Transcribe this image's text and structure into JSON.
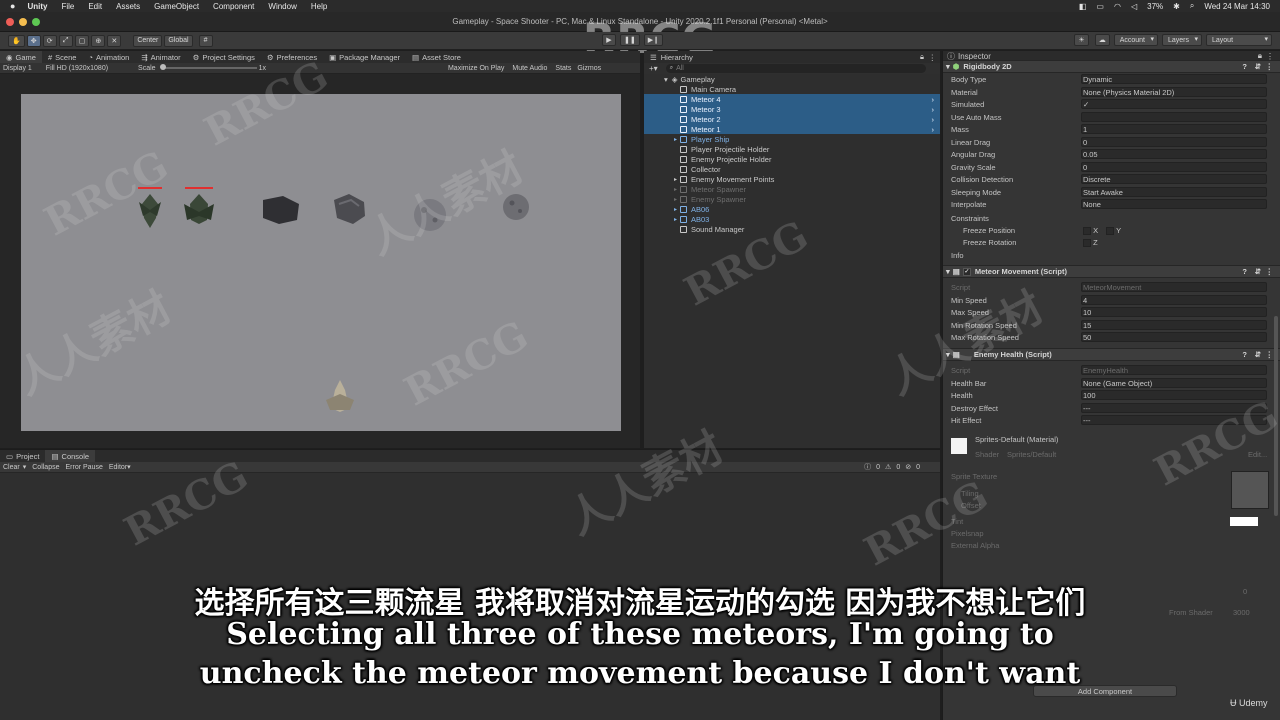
{
  "menubar": {
    "app": "Unity",
    "items": [
      "File",
      "Edit",
      "Assets",
      "GameObject",
      "Component",
      "Window",
      "Help"
    ],
    "battery": "37%",
    "datetime": "Wed 24 Mar  14:30"
  },
  "window": {
    "title": "Gameplay - Space Shooter - PC, Mac & Linux Standalone - Unity 2020.2.1f1 Personal (Personal) <Metal>"
  },
  "toolbar": {
    "pivot": "Center",
    "space": "Global",
    "account": "Account",
    "layers": "Layers",
    "layout": "Layout"
  },
  "tabs_top": [
    "Game",
    "Scene",
    "Animation",
    "Animator",
    "Project Settings",
    "Preferences",
    "Package Manager",
    "Asset Store"
  ],
  "game_view": {
    "display": "Display 1",
    "resolution": "Fill HD (1920x1080)",
    "scale_label": "Scale",
    "scale_value": "1x",
    "maximize": "Maximize On Play",
    "mute": "Mute Audio",
    "stats": "Stats",
    "gizmos": "Gizmos"
  },
  "hierarchy": {
    "title": "Hierarchy",
    "search_placeholder": "All",
    "scene": "Gameplay",
    "items": [
      {
        "label": "Main Camera",
        "style": "normal"
      },
      {
        "label": "Meteor 4",
        "style": "sel"
      },
      {
        "label": "Meteor 3",
        "style": "sel"
      },
      {
        "label": "Meteor 2",
        "style": "sel"
      },
      {
        "label": "Meteor 1",
        "style": "sel"
      },
      {
        "label": "Player Ship",
        "style": "blue"
      },
      {
        "label": "Player Projectile Holder",
        "style": "normal"
      },
      {
        "label": "Enemy Projectile Holder",
        "style": "normal"
      },
      {
        "label": "Collector",
        "style": "normal"
      },
      {
        "label": "Enemy Movement Points",
        "style": "normal"
      },
      {
        "label": "Meteor Spawner",
        "style": "dim"
      },
      {
        "label": "Enemy Spawner",
        "style": "dim"
      },
      {
        "label": "AB06",
        "style": "blue"
      },
      {
        "label": "AB03",
        "style": "blue"
      },
      {
        "label": "Sound Manager",
        "style": "normal"
      }
    ]
  },
  "inspector": {
    "title": "Inspector",
    "rigidbody": {
      "header": "Rigidbody 2D",
      "rows": [
        {
          "label": "Body Type",
          "value": "Dynamic"
        },
        {
          "label": "Material",
          "value": "None (Physics Material 2D)"
        },
        {
          "label": "Simulated",
          "value": "✓"
        },
        {
          "label": "Use Auto Mass",
          "value": ""
        },
        {
          "label": "Mass",
          "value": "1"
        },
        {
          "label": "Linear Drag",
          "value": "0"
        },
        {
          "label": "Angular Drag",
          "value": "0.05"
        },
        {
          "label": "Gravity Scale",
          "value": "0"
        },
        {
          "label": "Collision Detection",
          "value": "Discrete"
        },
        {
          "label": "Sleeping Mode",
          "value": "Start Awake"
        },
        {
          "label": "Interpolate",
          "value": "None"
        }
      ],
      "constraints": "Constraints",
      "freeze_pos": "Freeze Position",
      "freeze_rot": "Freeze Rotation",
      "info": "Info"
    },
    "meteor_movement": {
      "header": "Meteor Movement (Script)",
      "rows": [
        {
          "label": "Script",
          "value": "MeteorMovement"
        },
        {
          "label": "Min Speed",
          "value": "4"
        },
        {
          "label": "Max Speed",
          "value": "10"
        },
        {
          "label": "Min Rotation Speed",
          "value": "15"
        },
        {
          "label": "Max Rotation Speed",
          "value": "50"
        }
      ]
    },
    "enemy_health": {
      "header": "Enemy Health (Script)",
      "rows": [
        {
          "label": "Script",
          "value": "EnemyHealth"
        },
        {
          "label": "Health Bar",
          "value": "None (Game Object)"
        },
        {
          "label": "Health",
          "value": "100"
        },
        {
          "label": "Destroy Effect",
          "value": "---"
        },
        {
          "label": "Hit Effect",
          "value": "---"
        }
      ]
    },
    "material": {
      "name": "Sprites-Default (Material)",
      "shader_label": "Shader",
      "shader_value": "Sprites/Default",
      "edit": "Edit...",
      "sprite_texture": "Sprite Texture",
      "tiling": "Tiling",
      "offset": "Offset",
      "tint": "Tint",
      "pixel_snap": "Pixelsnap",
      "external_alpha": "External Alpha",
      "render_queue": "From Shader",
      "render_queue_value": "3000",
      "zero": "0"
    },
    "add_component": "Add Component"
  },
  "bottom": {
    "tabs": [
      "Project",
      "Console"
    ],
    "clear": "Clear",
    "collapse": "Collapse",
    "error_pause": "Error Pause",
    "editor": "Editor",
    "counts": [
      "0",
      "0",
      "0"
    ]
  },
  "watermark": {
    "brand": "RRCG",
    "cn": "人人素材",
    "udemy": "Udemy"
  },
  "subtitles": {
    "zh": "选择所有这三颗流星 我将取消对流星运动的勾选 因为我不想让它们",
    "en_line1": "Selecting all three of these meteors, I'm going to",
    "en_line2": "uncheck the meteor movement because I don't want"
  },
  "colors": {
    "selection": "#2c5d87",
    "canvas": "#8e8e92",
    "health_bar": "#e03030"
  }
}
